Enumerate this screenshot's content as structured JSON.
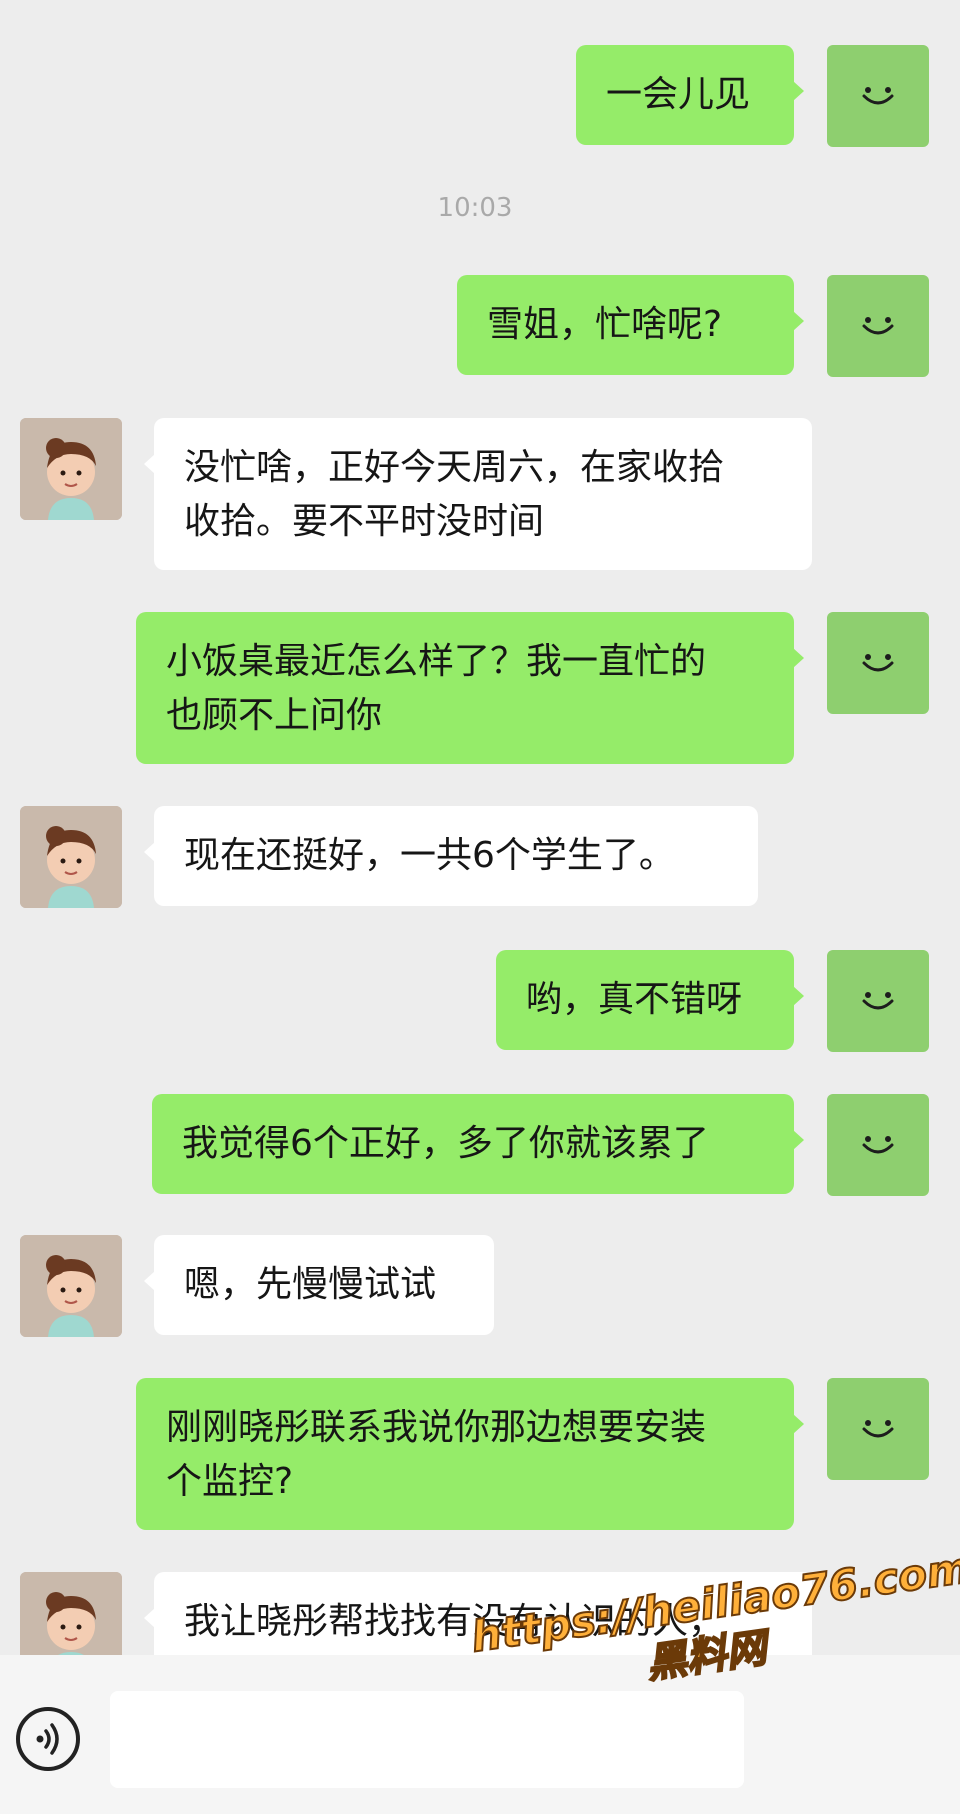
{
  "colors": {
    "background": "#ededed",
    "my_bubble": "#95ec69",
    "other_bubble": "#ffffff",
    "my_avatar": "#8ecf6f",
    "watermark": "#ffb03a"
  },
  "chat": {
    "timestamp": "10:03",
    "messages": [
      {
        "sender": "me",
        "text": "一会儿见"
      },
      {
        "sender": "me",
        "text": "雪姐，忙啥呢?"
      },
      {
        "sender": "other",
        "text": "没忙啥，正好今天周六，在家收拾\n收拾。要不平时没时间"
      },
      {
        "sender": "me",
        "text": "小饭桌最近怎么样了？我一直忙的\n也顾不上问你"
      },
      {
        "sender": "other",
        "text": "现在还挺好，一共6个学生了。"
      },
      {
        "sender": "me",
        "text": "哟，真不错呀"
      },
      {
        "sender": "me",
        "text": "我觉得6个正好，多了你就该累了"
      },
      {
        "sender": "other",
        "text": "嗯，先慢慢试试"
      },
      {
        "sender": "me",
        "text": "刚刚晓彤联系我说你那边想要安装\n个监控?"
      },
      {
        "sender": "other",
        "text": "我让晓彤帮找找有没有认识的人，\n我想安个监控"
      }
    ]
  },
  "input_bar": {
    "voice_icon": "voice-icon",
    "text_value": ""
  },
  "watermark": {
    "url": "https://heiliao76.com",
    "name": "黑料网"
  }
}
